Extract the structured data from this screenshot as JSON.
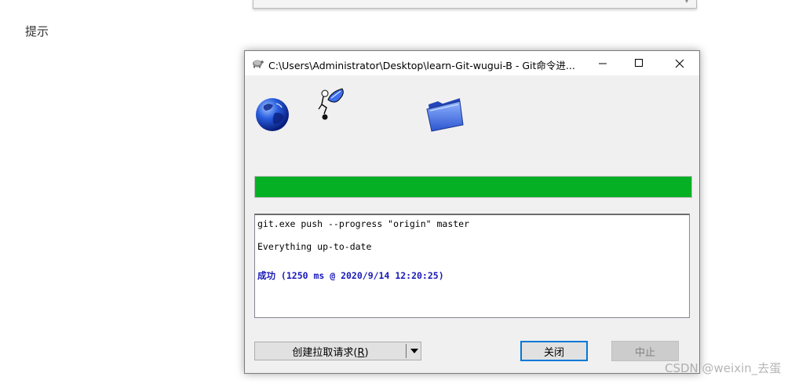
{
  "page": {
    "hint_label": "提示",
    "watermark": "CSDN @weixin_去蛋"
  },
  "dialog": {
    "title": "C:\\Users\\Administrator\\Desktop\\learn-Git-wugui-B - Git命令进...",
    "window_controls": {
      "minimize_icon": "minimize-icon",
      "maximize_icon": "maximize-icon",
      "close_icon": "close-icon"
    },
    "progress_fraction": 1.0,
    "progress_color": "#06b025",
    "log_lines": [
      "git.exe push --progress \"origin\" master",
      "Everything up-to-date",
      "成功 (1250 ms @ 2020/9/14 12:20:25)"
    ],
    "success_color": "#1a1ab8",
    "buttons": {
      "pull_request_prefix": "创建拉取请求(",
      "pull_request_hotkey": "R",
      "pull_request_suffix": ")",
      "close": "关闭",
      "abort": "中止"
    }
  }
}
